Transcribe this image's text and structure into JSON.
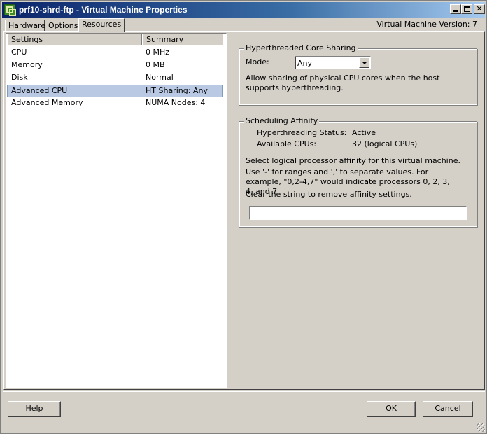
{
  "window": {
    "title": "prf10-shrd-ftp - Virtual Machine Properties",
    "version_text": "Virtual Machine Version: 7"
  },
  "tabs": [
    {
      "label": "Hardware",
      "active": false
    },
    {
      "label": "Options",
      "active": false
    },
    {
      "label": "Resources",
      "active": true
    }
  ],
  "settings_list": {
    "columns": [
      "Settings",
      "Summary"
    ],
    "rows": [
      {
        "setting": "CPU",
        "summary": "0 MHz",
        "selected": false
      },
      {
        "setting": "Memory",
        "summary": "0 MB",
        "selected": false
      },
      {
        "setting": "Disk",
        "summary": "Normal",
        "selected": false
      },
      {
        "setting": "Advanced CPU",
        "summary": "HT Sharing: Any",
        "selected": true
      },
      {
        "setting": "Advanced Memory",
        "summary": "NUMA Nodes: 4",
        "selected": false
      }
    ]
  },
  "ht_sharing": {
    "legend": "Hyperthreaded Core Sharing",
    "mode_label": "Mode:",
    "mode_value": "Any",
    "description": "Allow sharing of physical CPU cores when the host supports hyperthreading."
  },
  "affinity": {
    "legend": "Scheduling Affinity",
    "status_label": "Hyperthreading Status:",
    "status_value": "Active",
    "cpus_label": "Available CPUs:",
    "cpus_value": "32 (logical CPUs)",
    "instruction1": "Select logical processor affinity for this virtual machine.",
    "instruction2": "Use '-' for ranges and ',' to separate values. For example, \"0,2-4,7\" would indicate processors 0, 2, 3, 4, and 7.",
    "instruction3": "Clear the string to remove affinity settings.",
    "input_value": ""
  },
  "buttons": {
    "help": "Help",
    "ok": "OK",
    "cancel": "Cancel"
  }
}
